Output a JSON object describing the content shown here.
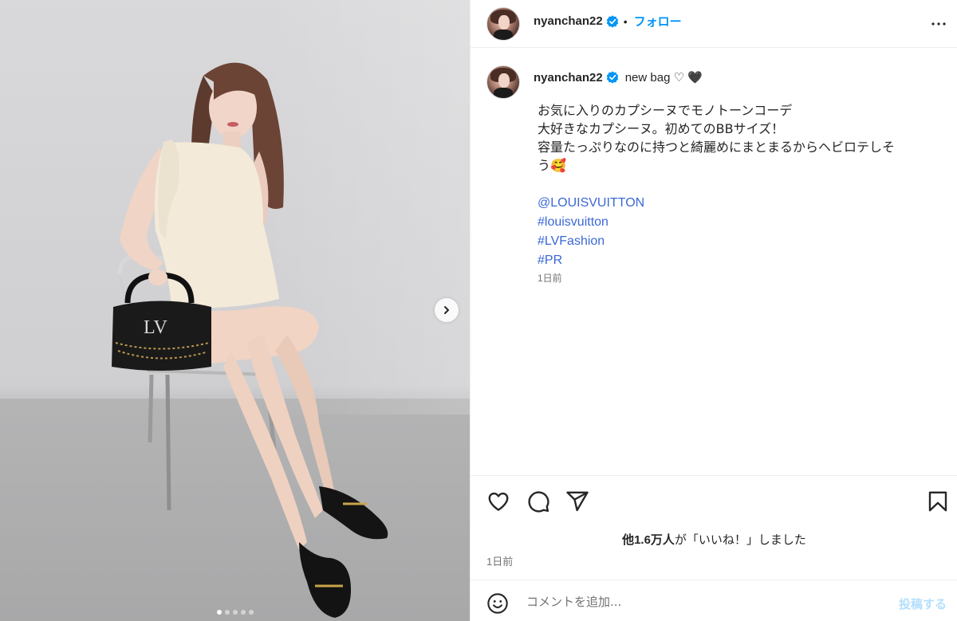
{
  "post": {
    "username": "nyanchan22",
    "bullet": "•",
    "follow_label": "フォロー",
    "caption_title": "new bag ♡ 🖤",
    "caption_lines": [
      "お気に入りのカプシーヌでモノトーンコーデ",
      "大好きなカプシーヌ。初めてのBBサイズ！",
      "容量たっぷりなのに持つと綺麗めにまとまるからヘビロテしそ",
      "う🥰"
    ],
    "tags": [
      "@LOUISVUITTON",
      "#louisvuitton",
      "#LVFashion",
      "#PR"
    ],
    "caption_time": "1日前",
    "likes_bold": "他1.6万人",
    "likes_rest": "が「いいね！」しました",
    "post_time": "1日前",
    "comment_placeholder": "コメントを追加...",
    "post_button": "投稿する"
  },
  "carousel": {
    "slides": 5,
    "active": 0
  },
  "colors": {
    "accent": "#0095f6",
    "link": "#3b68d6",
    "verified": "#0095f6",
    "muted": "#737373"
  },
  "icons": [
    "chevron-right-icon",
    "verified-badge-icon",
    "more-horizontal-icon",
    "heart-icon",
    "comment-icon",
    "share-icon",
    "bookmark-icon",
    "emoji-icon"
  ]
}
